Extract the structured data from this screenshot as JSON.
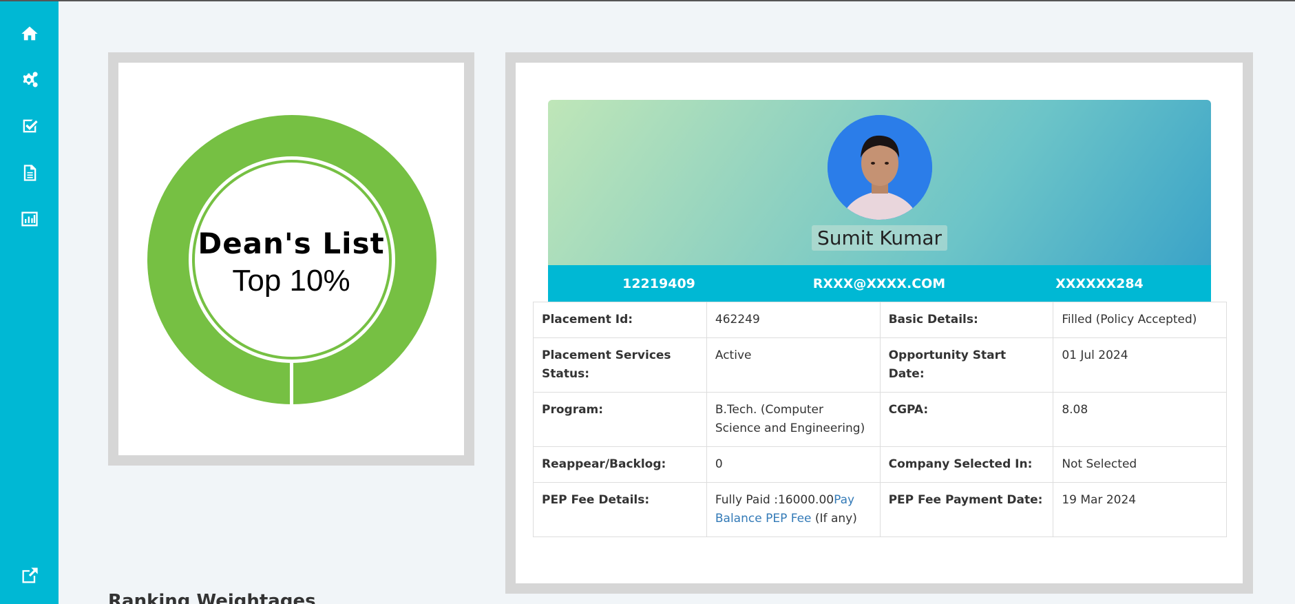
{
  "sidebar": {
    "icons": [
      "home-icon",
      "cogs-icon",
      "check-square-icon",
      "document-icon",
      "bar-chart-icon",
      "external-link-icon"
    ]
  },
  "deans_card": {
    "title": "Dean's List",
    "subtitle": "Top 10%",
    "ring_color": "#76c043"
  },
  "profile": {
    "name": "Sumit Kumar",
    "registration_no": "12219409",
    "email": "RXXX@XXXX.COM",
    "phone": "XXXXXX284"
  },
  "details": {
    "placement_id_label": "Placement Id:",
    "placement_id_value": "462249",
    "basic_details_label": "Basic Details:",
    "basic_details_value": "Filled (Policy Accepted)",
    "services_status_label": "Placement Services Status:",
    "services_status_value": "Active",
    "opportunity_start_label": "Opportunity Start Date:",
    "opportunity_start_value": "01 Jul 2024",
    "program_label": "Program:",
    "program_value": "B.Tech. (Computer Science and Engineering)",
    "cgpa_label": "CGPA:",
    "cgpa_value": "8.08",
    "backlog_label": "Reappear/Backlog:",
    "backlog_value": "0",
    "company_selected_label": "Company Selected In:",
    "company_selected_value": "Not Selected",
    "pep_fee_label": "PEP Fee Details:",
    "pep_fee_value": "Fully Paid :16000.00",
    "pep_fee_link": "Pay Balance PEP Fee",
    "pep_fee_suffix": " (If any)",
    "pep_payment_date_label": "PEP Fee Payment Date:",
    "pep_payment_date_value": "19 Mar 2024"
  },
  "ranking": {
    "heading": "Ranking Weightages"
  },
  "colors": {
    "sidebar": "#00b8d4",
    "info_bar": "#00b8d4",
    "link": "#337ab7"
  }
}
